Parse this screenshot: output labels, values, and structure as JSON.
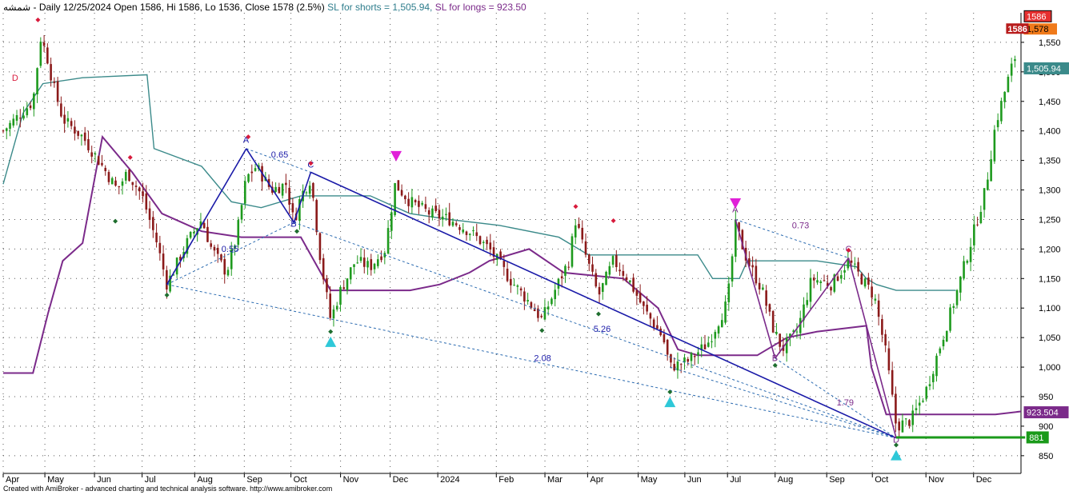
{
  "header": {
    "symbol": "شمشه",
    "info": "- Daily 12/25/2024 Open 1586, Hi 1586, Lo 1536, Close 1578 (2.5%)",
    "sl_shorts": "SL for shorts  = 1,505.94,",
    "sl_longs": "SL for longs  = 923.50"
  },
  "footer": {
    "credit": "Created with AmiBroker - advanced charting and technical analysis software. http://www.amibroker.com"
  },
  "colors": {
    "up": "#1e9a1e",
    "down": "#8b1a1a",
    "trend": "#1a1aa8",
    "ref": "#2a6ab0",
    "teal": "#3b8a8a",
    "purple": "#7b2a8a",
    "pivot_hi": "#d81b3c",
    "pivot_lo": "#1e6e2e",
    "magenta": "#e020d8",
    "cyan": "#2ec8d8",
    "green_line": "#1a9a1a"
  },
  "chart_data": {
    "type": "candlestick",
    "y_ticks": [
      850,
      900,
      950,
      1000,
      1050,
      1100,
      1150,
      1200,
      1250,
      1300,
      1350,
      1400,
      1450,
      1500,
      1550
    ],
    "y_tick_labels": [
      "850",
      "900",
      "950",
      "1,000",
      "1,050",
      "1,100",
      "1,150",
      "1,200",
      "1,250",
      "1,300",
      "1,350",
      "1,400",
      "1,450",
      "1,500",
      "1,550"
    ],
    "ylim": [
      820,
      1600
    ],
    "x_labels": [
      {
        "t": 0,
        "label": "Apr"
      },
      {
        "t": 0.042,
        "label": "May"
      },
      {
        "t": 0.092,
        "label": "Jun"
      },
      {
        "t": 0.14,
        "label": "Jul"
      },
      {
        "t": 0.193,
        "label": "Aug"
      },
      {
        "t": 0.243,
        "label": "Sep"
      },
      {
        "t": 0.29,
        "label": "Oct"
      },
      {
        "t": 0.34,
        "label": "Nov"
      },
      {
        "t": 0.39,
        "label": "Dec"
      },
      {
        "t": 0.438,
        "label": "2024"
      },
      {
        "t": 0.497,
        "label": "Feb"
      },
      {
        "t": 0.546,
        "label": "Mar"
      },
      {
        "t": 0.589,
        "label": "Apr"
      },
      {
        "t": 0.64,
        "label": "May"
      },
      {
        "t": 0.687,
        "label": "Jun"
      },
      {
        "t": 0.73,
        "label": "Jul"
      },
      {
        "t": 0.778,
        "label": "Aug"
      },
      {
        "t": 0.83,
        "label": "Sep"
      },
      {
        "t": 0.876,
        "label": "Oct"
      },
      {
        "t": 0.93,
        "label": "Nov"
      },
      {
        "t": 0.978,
        "label": "Dec"
      }
    ],
    "price_path": [
      [
        0,
        1400
      ],
      [
        0.03,
        1450
      ],
      [
        0.038,
        1560
      ],
      [
        0.045,
        1520
      ],
      [
        0.05,
        1480
      ],
      [
        0.06,
        1420
      ],
      [
        0.08,
        1390
      ],
      [
        0.1,
        1340
      ],
      [
        0.115,
        1300
      ],
      [
        0.125,
        1330
      ],
      [
        0.14,
        1290
      ],
      [
        0.155,
        1210
      ],
      [
        0.165,
        1140
      ],
      [
        0.185,
        1210
      ],
      [
        0.2,
        1250
      ],
      [
        0.21,
        1200
      ],
      [
        0.225,
        1160
      ],
      [
        0.235,
        1220
      ],
      [
        0.245,
        1320
      ],
      [
        0.255,
        1340
      ],
      [
        0.27,
        1300
      ],
      [
        0.285,
        1310
      ],
      [
        0.293,
        1245
      ],
      [
        0.3,
        1290
      ],
      [
        0.31,
        1320
      ],
      [
        0.32,
        1180
      ],
      [
        0.33,
        1080
      ],
      [
        0.34,
        1130
      ],
      [
        0.355,
        1180
      ],
      [
        0.37,
        1170
      ],
      [
        0.385,
        1200
      ],
      [
        0.395,
        1310
      ],
      [
        0.41,
        1280
      ],
      [
        0.43,
        1260
      ],
      [
        0.45,
        1250
      ],
      [
        0.47,
        1230
      ],
      [
        0.49,
        1200
      ],
      [
        0.51,
        1150
      ],
      [
        0.53,
        1110
      ],
      [
        0.543,
        1080
      ],
      [
        0.556,
        1130
      ],
      [
        0.57,
        1180
      ],
      [
        0.577,
        1250
      ],
      [
        0.585,
        1200
      ],
      [
        0.6,
        1120
      ],
      [
        0.615,
        1180
      ],
      [
        0.63,
        1150
      ],
      [
        0.645,
        1100
      ],
      [
        0.665,
        1050
      ],
      [
        0.672,
        1000
      ],
      [
        0.69,
        1010
      ],
      [
        0.71,
        1040
      ],
      [
        0.73,
        1110
      ],
      [
        0.738,
        1240
      ],
      [
        0.75,
        1180
      ],
      [
        0.765,
        1130
      ],
      [
        0.775,
        1070
      ],
      [
        0.785,
        1030
      ],
      [
        0.8,
        1060
      ],
      [
        0.815,
        1150
      ],
      [
        0.835,
        1140
      ],
      [
        0.852,
        1180
      ],
      [
        0.865,
        1150
      ],
      [
        0.878,
        1120
      ],
      [
        0.89,
        1020
      ],
      [
        0.9,
        900
      ],
      [
        0.915,
        910
      ],
      [
        0.93,
        960
      ],
      [
        0.945,
        1040
      ],
      [
        0.96,
        1120
      ],
      [
        0.975,
        1210
      ],
      [
        0.99,
        1300
      ],
      [
        1.0,
        1410
      ],
      [
        1.015,
        1500
      ],
      [
        1.03,
        1578
      ]
    ],
    "teal_line": [
      [
        0,
        1310
      ],
      [
        0.02,
        1430
      ],
      [
        0.04,
        1480
      ],
      [
        0.08,
        1490
      ],
      [
        0.145,
        1495
      ],
      [
        0.152,
        1370
      ],
      [
        0.2,
        1340
      ],
      [
        0.23,
        1280
      ],
      [
        0.26,
        1270
      ],
      [
        0.3,
        1290
      ],
      [
        0.33,
        1290
      ],
      [
        0.37,
        1290
      ],
      [
        0.41,
        1260
      ],
      [
        0.45,
        1250
      ],
      [
        0.5,
        1240
      ],
      [
        0.56,
        1220
      ],
      [
        0.59,
        1190
      ],
      [
        0.64,
        1190
      ],
      [
        0.7,
        1190
      ],
      [
        0.715,
        1150
      ],
      [
        0.742,
        1150
      ],
      [
        0.75,
        1180
      ],
      [
        0.82,
        1180
      ],
      [
        0.86,
        1170
      ],
      [
        0.87,
        1150
      ],
      [
        0.88,
        1140
      ],
      [
        0.9,
        1130
      ],
      [
        0.95,
        1130
      ],
      [
        0.96,
        1130
      ]
    ],
    "purple_line": [
      [
        0,
        990
      ],
      [
        0.03,
        990
      ],
      [
        0.045,
        1090
      ],
      [
        0.06,
        1180
      ],
      [
        0.08,
        1210
      ],
      [
        0.1,
        1390
      ],
      [
        0.13,
        1330
      ],
      [
        0.16,
        1260
      ],
      [
        0.2,
        1230
      ],
      [
        0.24,
        1220
      ],
      [
        0.3,
        1220
      ],
      [
        0.33,
        1130
      ],
      [
        0.41,
        1130
      ],
      [
        0.44,
        1140
      ],
      [
        0.47,
        1160
      ],
      [
        0.49,
        1180
      ],
      [
        0.53,
        1200
      ],
      [
        0.565,
        1160
      ],
      [
        0.625,
        1150
      ],
      [
        0.66,
        1100
      ],
      [
        0.68,
        1030
      ],
      [
        0.7,
        1020
      ],
      [
        0.76,
        1020
      ],
      [
        0.79,
        1050
      ],
      [
        0.82,
        1060
      ],
      [
        0.87,
        1070
      ],
      [
        0.875,
        1000
      ],
      [
        0.89,
        920
      ],
      [
        0.95,
        920
      ],
      [
        1.0,
        920
      ],
      [
        1.05,
        925
      ]
    ],
    "trend_lines": [
      {
        "from": [
          0.165,
          1140
        ],
        "to": [
          0.245,
          1370
        ]
      },
      {
        "from": [
          0.245,
          1370
        ],
        "to": [
          0.293,
          1245
        ]
      },
      {
        "from": [
          0.293,
          1245
        ],
        "to": [
          0.31,
          1330
        ]
      },
      {
        "from": [
          0.31,
          1330
        ],
        "to": [
          0.9,
          880
        ]
      },
      {
        "from": [
          0.738,
          1250
        ],
        "to": [
          0.778,
          1015
        ]
      },
      {
        "from": [
          0.778,
          1015
        ],
        "to": [
          0.852,
          1185
        ]
      },
      {
        "from": [
          0.852,
          1185
        ],
        "to": [
          0.9,
          880
        ]
      }
    ],
    "ref_lines": [
      {
        "from": [
          0.165,
          1140
        ],
        "to": [
          0.293,
          1245
        ]
      },
      {
        "from": [
          0.165,
          1140
        ],
        "to": [
          0.9,
          880
        ]
      },
      {
        "from": [
          0.245,
          1370
        ],
        "to": [
          0.31,
          1330
        ]
      },
      {
        "from": [
          0.293,
          1245
        ],
        "to": [
          0.9,
          880
        ]
      },
      {
        "from": [
          0.672,
          1000
        ],
        "to": [
          0.9,
          880
        ]
      },
      {
        "from": [
          0.738,
          1250
        ],
        "to": [
          0.852,
          1185
        ]
      },
      {
        "from": [
          0.778,
          1015
        ],
        "to": [
          0.9,
          880
        ]
      }
    ],
    "ratio_labels": [
      {
        "text": "0.65",
        "at": [
          0.27,
          1355
        ]
      },
      {
        "text": "0.55",
        "at": [
          0.22,
          1195
        ]
      },
      {
        "text": "5.26",
        "at": [
          0.595,
          1060
        ]
      },
      {
        "text": "2.08",
        "at": [
          0.535,
          1010
        ]
      },
      {
        "text": "0.73",
        "at": [
          0.795,
          1235
        ]
      },
      {
        "text": "1.79",
        "at": [
          0.84,
          935
        ]
      }
    ],
    "point_labels": [
      {
        "text": "D",
        "at": [
          0.012,
          1485
        ]
      },
      {
        "text": "A",
        "at": [
          0.245,
          1380
        ]
      },
      {
        "text": "B",
        "at": [
          0.293,
          1238
        ]
      },
      {
        "text": "C",
        "at": [
          0.31,
          1338
        ]
      },
      {
        "text": "A",
        "at": [
          0.738,
          1262
        ]
      },
      {
        "text": "B",
        "at": [
          0.778,
          1010
        ]
      },
      {
        "text": "C",
        "at": [
          0.852,
          1195
        ]
      },
      {
        "text": "D",
        "at": [
          0.9,
          872
        ]
      }
    ],
    "pivot_highs": [
      [
        0.035,
        1588
      ],
      [
        0.128,
        1355
      ],
      [
        0.247,
        1390
      ],
      [
        0.31,
        1345
      ],
      [
        0.577,
        1272
      ],
      [
        0.615,
        1248
      ],
      [
        0.852,
        1198
      ]
    ],
    "pivot_lows": [
      [
        0.165,
        1122
      ],
      [
        0.113,
        1247
      ],
      [
        0.296,
        1230
      ],
      [
        0.33,
        1060
      ],
      [
        0.543,
        1062
      ],
      [
        0.6,
        1090
      ],
      [
        0.672,
        958
      ],
      [
        0.778,
        1003
      ],
      [
        0.9,
        868
      ]
    ],
    "down_arrows": [
      [
        0.396,
        1355
      ],
      [
        0.738,
        1275
      ]
    ],
    "up_arrows": [
      [
        0.33,
        1045
      ],
      [
        0.672,
        943
      ],
      [
        0.9,
        853
      ]
    ],
    "green_level": {
      "value": 881,
      "from": 0.9,
      "to": 1.03
    },
    "price_badges": [
      {
        "value": 1586,
        "text": "1586",
        "kind": "high"
      },
      {
        "value": 1578,
        "text": "1,578",
        "kind": "close"
      },
      {
        "value": 1505.94,
        "text": "1,505.94",
        "kind": "sl_shorts"
      },
      {
        "value": 923.504,
        "text": "923.504",
        "kind": "sl_longs"
      },
      {
        "value": 881,
        "text": "881",
        "kind": "level"
      }
    ],
    "chart_badges": [
      {
        "value": 1578,
        "text": "1586",
        "at": 1.035
      }
    ]
  }
}
